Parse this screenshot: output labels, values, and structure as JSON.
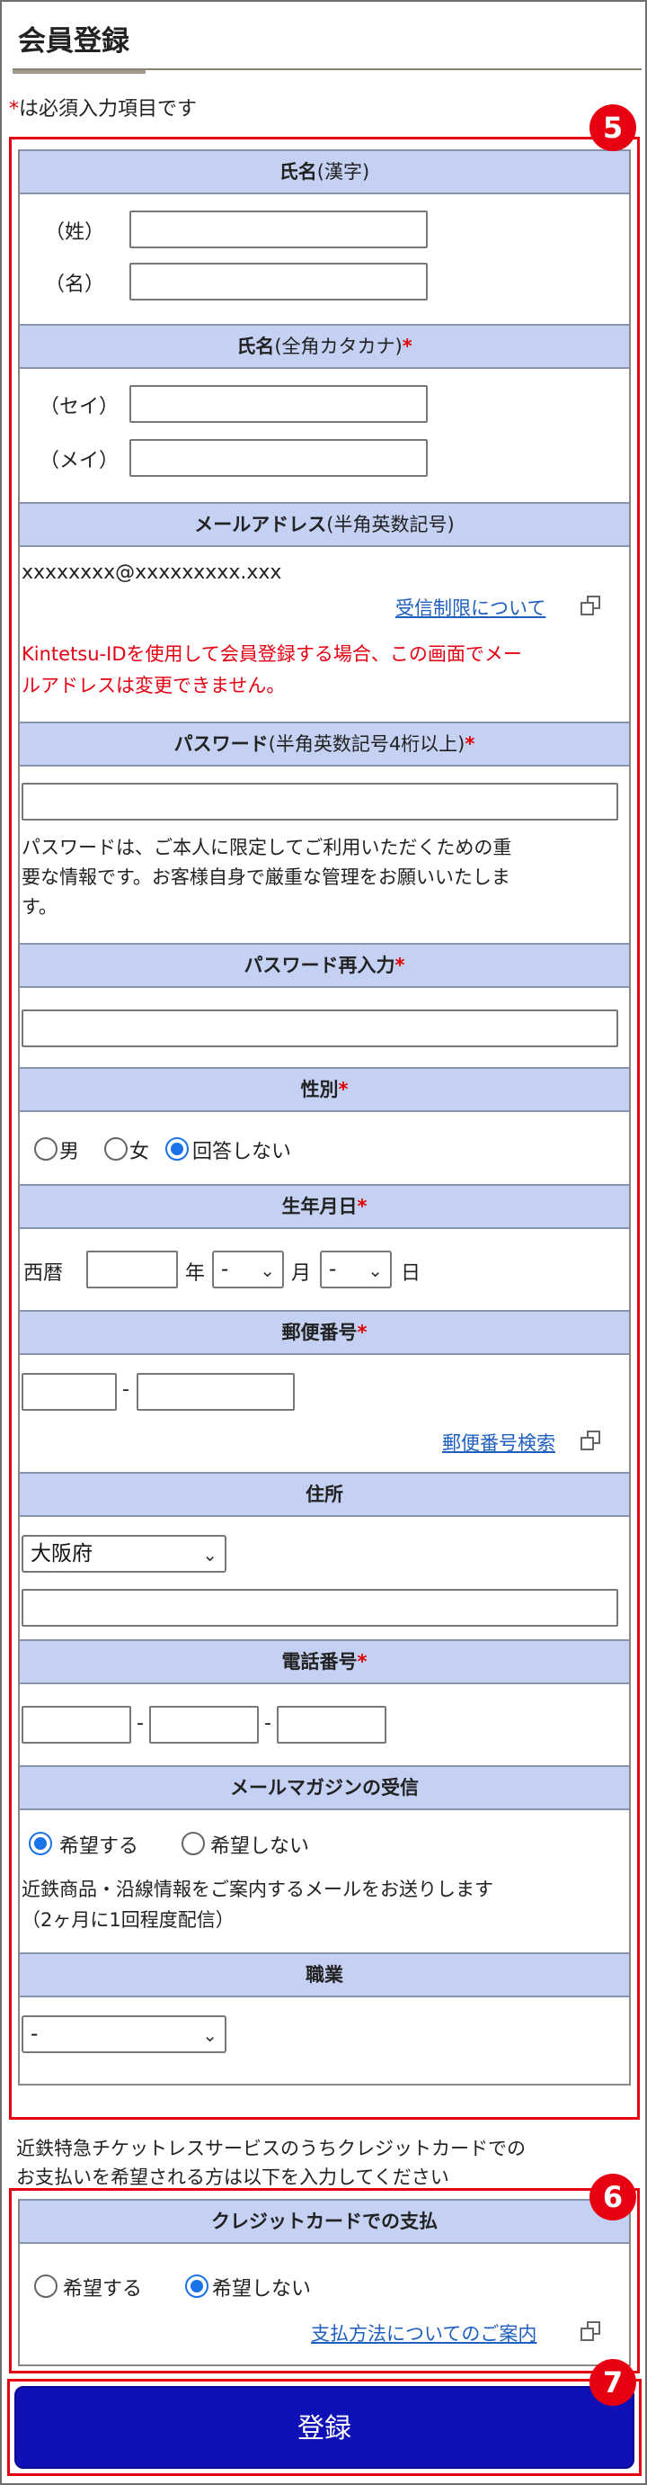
{
  "page": {
    "title": "会員登録",
    "required_prefix": "*",
    "required_note": "は必須入力項目です"
  },
  "badges": {
    "b5": "5",
    "b6": "6",
    "b7": "7"
  },
  "name_kanji": {
    "head": "氏名",
    "head_sub": "(漢字)",
    "sei_label": "（姓）",
    "mei_label": "（名）"
  },
  "name_kana": {
    "head": "氏名",
    "head_sub": "(全角カタカナ)",
    "req": "*",
    "sei_label": "（セイ）",
    "mei_label": "（メイ）"
  },
  "email": {
    "head": "メールアドレス",
    "head_sub": "(半角英数記号)",
    "value": "xxxxxxxx@xxxxxxxxx.xxx",
    "link": "受信制限について",
    "warning_line1": "Kintetsu-IDを使用して会員登録する場合、この画面でメー",
    "warning_line2": "ルアドレスは変更できません。"
  },
  "password": {
    "head": "パスワード",
    "head_sub": "(半角英数記号4桁以上)",
    "req": "*",
    "note_line1": "パスワードは、ご本人に限定してご利用いただくための重",
    "note_line2": "要な情報です。お客様自身で厳重な管理をお願いいたしま",
    "note_line3": "す。"
  },
  "password_confirm": {
    "head": "パスワード再入力",
    "req": "*"
  },
  "gender": {
    "head": "性別",
    "req": "*",
    "opt_male": "男",
    "opt_female": "女",
    "opt_none": "回答しない",
    "selected": "回答しない"
  },
  "birth": {
    "head": "生年月日",
    "req": "*",
    "era": "西暦",
    "year": "年",
    "month_value": "-",
    "month": "月",
    "day_value": "-",
    "day": "日"
  },
  "postal": {
    "head": "郵便番号",
    "req": "*",
    "dash": "-",
    "link": "郵便番号検索"
  },
  "address": {
    "head": "住所",
    "prefecture": "大阪府"
  },
  "phone": {
    "head": "電話番号",
    "req": "*",
    "dash1": "-",
    "dash2": "-"
  },
  "magazine": {
    "head": "メールマガジンの受信",
    "opt_yes": "希望する",
    "opt_no": "希望しない",
    "selected": "希望する",
    "note_line1": "近鉄商品・沿線情報をご案内するメールをお送りします",
    "note_line2": "（2ヶ月に1回程度配信）"
  },
  "occupation": {
    "head": "職業",
    "value": "-"
  },
  "credit": {
    "intro_line1": "近鉄特急チケットレスサービスのうちクレジットカードでの",
    "intro_line2": "お支払いを希望される方は以下を入力してください",
    "head": "クレジットカードでの支払",
    "opt_yes": "希望する",
    "opt_no": "希望しない",
    "selected": "希望しない",
    "link": "支払方法についてのご案内"
  },
  "submit": {
    "label": "登録"
  },
  "colors": {
    "accent_red": "#e60012",
    "section_head": "#c5d1f3",
    "submit_blue": "#1010b7",
    "link_blue": "#1f5fbf"
  }
}
